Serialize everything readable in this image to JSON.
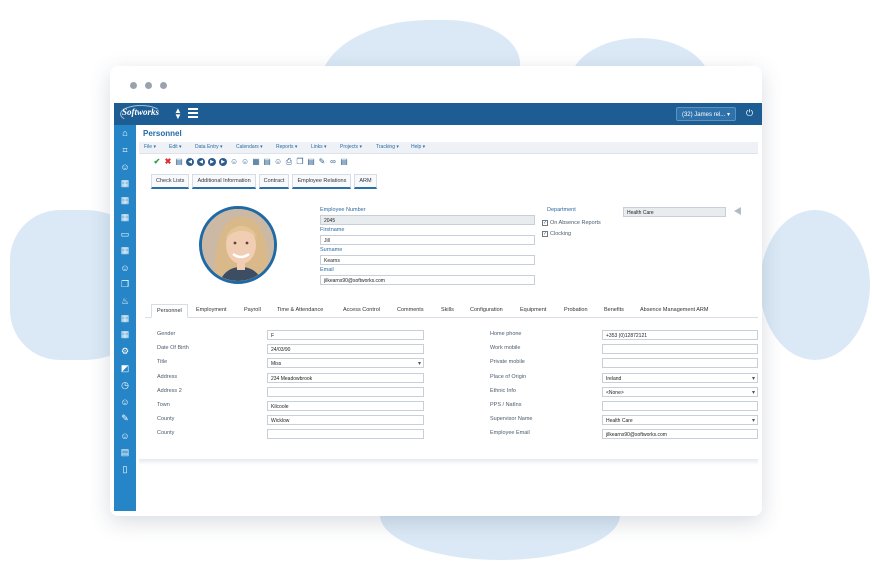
{
  "app": {
    "logo": "Softworks",
    "user_button": "(32) James rel..."
  },
  "page": {
    "title": "Personnel"
  },
  "menu": [
    "File ▾",
    "Edit ▾",
    "Data Entry ▾",
    "Calendars ▾",
    "Reports ▾",
    "Links ▾",
    "Projects ▾",
    "Tracking ▾",
    "Help ▾"
  ],
  "subtabs": [
    "Check Lists",
    "Additional Information",
    "Contract",
    "Employee Relations",
    "ARM"
  ],
  "header_fields": {
    "employee_number_label": "Employee Number",
    "employee_number": "2045",
    "firstname_label": "Firstname",
    "firstname": "Jill",
    "surname_label": "Surname",
    "surname": "Kearns",
    "email_label": "Email",
    "email": "jilkearns90@softworks.com",
    "department_label": "Department",
    "department": "Health Care",
    "on_absence_reports_label": "On Absence Reports",
    "clocking_label": "Clocking"
  },
  "tabs": [
    "Personnel",
    "Employment",
    "Payroll",
    "Time & Attendance",
    "Access Control",
    "Comments",
    "Skills",
    "Configuration",
    "Equipment",
    "Probation",
    "Benefits",
    "Absence Management ARM"
  ],
  "form_left": [
    {
      "label": "Gender",
      "value": "F"
    },
    {
      "label": "Date Of Birth",
      "value": "24/03/90"
    },
    {
      "label": "Title",
      "value": "Miss"
    },
    {
      "label": "Address",
      "value": "234 Meadowbrook"
    },
    {
      "label": "Address 2",
      "value": ""
    },
    {
      "label": "Town",
      "value": "Kilcoole"
    },
    {
      "label": "County",
      "value": "Wicklow"
    },
    {
      "label": "County",
      "value": ""
    }
  ],
  "form_right": [
    {
      "label": "Home phone",
      "value": "+353 (0)12872121"
    },
    {
      "label": "Work mobile",
      "value": ""
    },
    {
      "label": "Private mobile",
      "value": ""
    },
    {
      "label": "Place of Origin",
      "value": "Ireland"
    },
    {
      "label": "Ethnic Info",
      "value": "<None>"
    },
    {
      "label": "PPS / NatIns",
      "value": ""
    },
    {
      "label": "Supervisor Name",
      "value": "Health Care"
    },
    {
      "label": "Employee Email",
      "value": "jilkearns90@softworks.com"
    }
  ],
  "colors": {
    "accent": "#1d5d93",
    "sidebar": "#2585c7",
    "background_blob": "#dbe9f6"
  }
}
